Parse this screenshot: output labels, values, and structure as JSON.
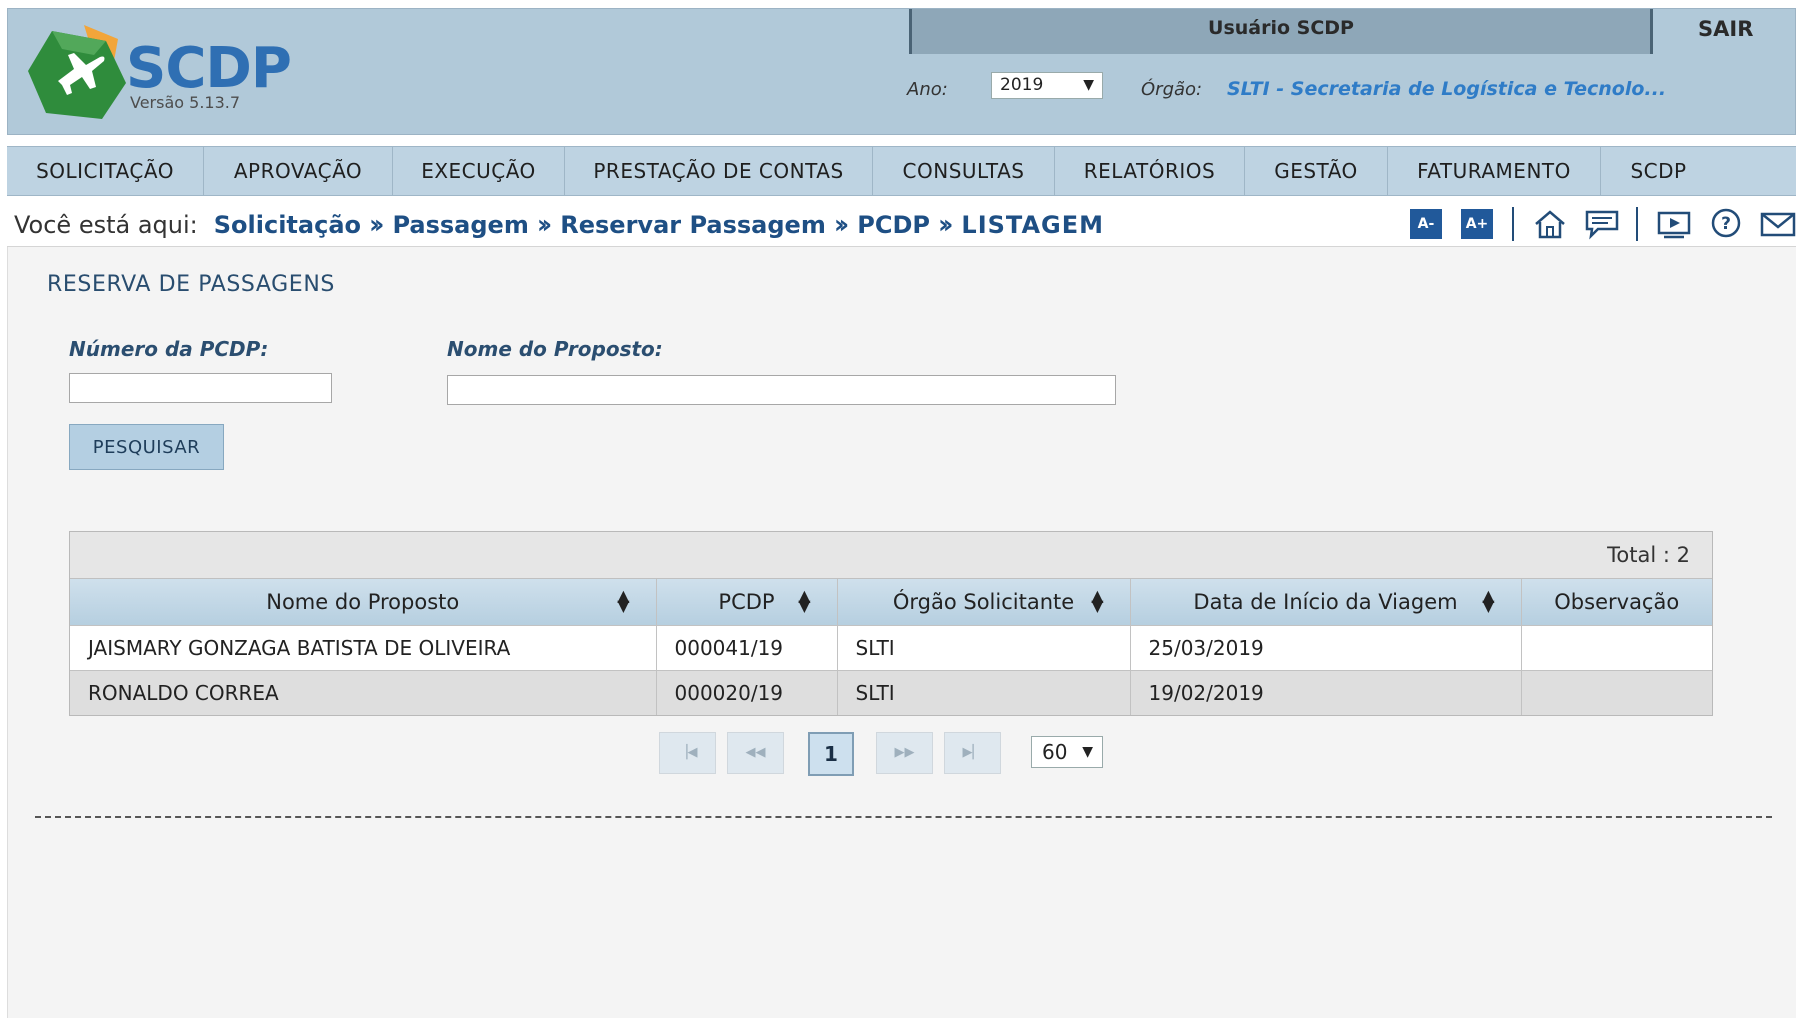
{
  "header": {
    "brand": "SCDP",
    "version": "Versão 5.13.7",
    "user": "Usuário SCDP",
    "logout": "SAIR",
    "ano_label": "Ano:",
    "ano_value": "2019",
    "orgao_label": "Órgão:",
    "orgao_value": "SLTI - Secretaria de Logística e Tecnolo..."
  },
  "menu": [
    "SOLICITAÇÃO",
    "APROVAÇÃO",
    "EXECUÇÃO",
    "PRESTAÇÃO DE CONTAS",
    "CONSULTAS",
    "RELATÓRIOS",
    "GESTÃO",
    "FATURAMENTO",
    "SCDP"
  ],
  "breadcrumb": {
    "prefix": "Você está aqui:",
    "items": [
      "Solicitação",
      "Passagem",
      "Reservar Passagem",
      "PCDP",
      "LISTAGEM"
    ]
  },
  "toolbar": {
    "font_decrease": "A-",
    "font_increase": "A+",
    "icons": [
      "home-icon",
      "chat-icon",
      "video-icon",
      "help-icon",
      "mail-icon"
    ]
  },
  "page": {
    "title": "RESERVA DE PASSAGENS",
    "pcdp_label": "Número da PCDP:",
    "pcdp_value": "",
    "nome_label": "Nome do Proposto:",
    "nome_value": "",
    "search_button": "PESQUISAR"
  },
  "table": {
    "total": "Total : 2",
    "columns": [
      "Nome do Proposto",
      "PCDP",
      "Órgão Solicitante",
      "Data de Início da Viagem",
      "Observação"
    ],
    "rows": [
      [
        "JAISMARY GONZAGA BATISTA DE OLIVEIRA",
        "000041/19",
        "SLTI",
        "25/03/2019",
        ""
      ],
      [
        "RONALDO CORREA",
        "000020/19",
        "SLTI",
        "19/02/2019",
        ""
      ]
    ]
  },
  "pagination": {
    "current_page": "1",
    "rows_per_page": "60"
  },
  "colors": {
    "header_bg": "#b1c9d9",
    "menu_bg": "#bed3e2",
    "link_blue": "#1e4f84",
    "orgao_blue": "#2f7cc7",
    "brand_blue": "#2f6fb3",
    "logo_green": "#2f8c3c",
    "logo_orange": "#f2a53a"
  }
}
